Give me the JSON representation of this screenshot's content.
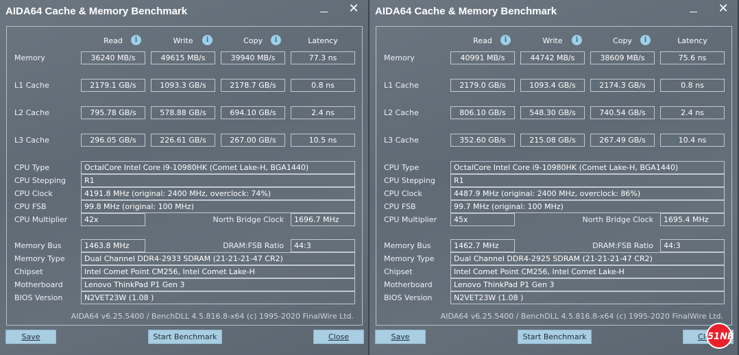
{
  "windows": [
    {
      "title": "AIDA64 Cache & Memory Benchmark",
      "headers": {
        "read": "Read",
        "write": "Write",
        "copy": "Copy",
        "latency": "Latency"
      },
      "bench": [
        {
          "label": "Memory",
          "read": "36240 MB/s",
          "write": "49615 MB/s",
          "copy": "39940 MB/s",
          "latency": "77.3 ns"
        },
        {
          "label": "L1 Cache",
          "read": "2179.1 GB/s",
          "write": "1093.3 GB/s",
          "copy": "2178.7 GB/s",
          "latency": "0.8 ns"
        },
        {
          "label": "L2 Cache",
          "read": "795.78 GB/s",
          "write": "578.88 GB/s",
          "copy": "694.10 GB/s",
          "latency": "2.4 ns"
        },
        {
          "label": "L3 Cache",
          "read": "296.05 GB/s",
          "write": "226.61 GB/s",
          "copy": "267.00 GB/s",
          "latency": "10.5 ns"
        }
      ],
      "info": {
        "cpu_type_label": "CPU Type",
        "cpu_type": "OctalCore Intel Core i9-10980HK  (Comet Lake-H, BGA1440)",
        "cpu_stepping_label": "CPU Stepping",
        "cpu_stepping": "R1",
        "cpu_clock_label": "CPU Clock",
        "cpu_clock": "4191.8 MHz  (original: 2400 MHz, overclock: 74%)",
        "cpu_fsb_label": "CPU FSB",
        "cpu_fsb": "99.8 MHz  (original: 100 MHz)",
        "cpu_multiplier_label": "CPU Multiplier",
        "cpu_multiplier": "42x",
        "nb_clock_label": "North Bridge Clock",
        "nb_clock": "1696.7 MHz",
        "memory_bus_label": "Memory Bus",
        "memory_bus": "1463.8 MHz",
        "dram_fsb_label": "DRAM:FSB Ratio",
        "dram_fsb": "44:3",
        "memory_type_label": "Memory Type",
        "memory_type": "Dual Channel DDR4-2933 SDRAM  (21-21-21-47 CR2)",
        "chipset_label": "Chipset",
        "chipset": "Intel Comet Point CM256, Intel Comet Lake-H",
        "motherboard_label": "Motherboard",
        "motherboard": "Lenovo ThinkPad P1 Gen 3",
        "bios_label": "BIOS Version",
        "bios": "N2VET23W (1.08 )"
      },
      "footer": "AIDA64 v6.25.5400 / BenchDLL 4.5.816.8-x64  (c) 1995-2020 FinalWire Ltd.",
      "buttons": {
        "save": "Save",
        "start": "Start Benchmark",
        "close": "Close"
      }
    },
    {
      "title": "AIDA64 Cache & Memory Benchmark",
      "headers": {
        "read": "Read",
        "write": "Write",
        "copy": "Copy",
        "latency": "Latency"
      },
      "bench": [
        {
          "label": "Memory",
          "read": "40991 MB/s",
          "write": "44742 MB/s",
          "copy": "38609 MB/s",
          "latency": "75.6 ns"
        },
        {
          "label": "L1 Cache",
          "read": "2179.0 GB/s",
          "write": "1093.4 GB/s",
          "copy": "2174.3 GB/s",
          "latency": "0.8 ns"
        },
        {
          "label": "L2 Cache",
          "read": "806.10 GB/s",
          "write": "548.30 GB/s",
          "copy": "740.54 GB/s",
          "latency": "2.4 ns"
        },
        {
          "label": "L3 Cache",
          "read": "352.60 GB/s",
          "write": "215.08 GB/s",
          "copy": "267.49 GB/s",
          "latency": "10.4 ns"
        }
      ],
      "info": {
        "cpu_type_label": "CPU Type",
        "cpu_type": "OctalCore Intel Core i9-10980HK  (Comet Lake-H, BGA1440)",
        "cpu_stepping_label": "CPU Stepping",
        "cpu_stepping": "R1",
        "cpu_clock_label": "CPU Clock",
        "cpu_clock": "4487.9 MHz  (original: 2400 MHz, overclock: 86%)",
        "cpu_fsb_label": "CPU FSB",
        "cpu_fsb": "99.7 MHz  (original: 100 MHz)",
        "cpu_multiplier_label": "CPU Multiplier",
        "cpu_multiplier": "45x",
        "nb_clock_label": "North Bridge Clock",
        "nb_clock": "1695.4 MHz",
        "memory_bus_label": "Memory Bus",
        "memory_bus": "1462.7 MHz",
        "dram_fsb_label": "DRAM:FSB Ratio",
        "dram_fsb": "44:3",
        "memory_type_label": "Memory Type",
        "memory_type": "Dual Channel DDR4-2925 SDRAM  (21-21-21-47 CR2)",
        "chipset_label": "Chipset",
        "chipset": "Intel Comet Point CM256, Intel Comet Lake-H",
        "motherboard_label": "Motherboard",
        "motherboard": "Lenovo ThinkPad P1 Gen 3",
        "bios_label": "BIOS Version",
        "bios": "N2VET23W (1.08 )"
      },
      "footer": "AIDA64 v6.25.5400 / BenchDLL 4.5.816.8-x64  (c) 1995-2020 FinalWire Ltd.",
      "buttons": {
        "save": "Save",
        "start": "Start Benchmark",
        "close": "Close"
      }
    }
  ],
  "watermark": "51NB",
  "icons": {
    "info": "info-icon",
    "minimize": "minimize-icon",
    "close": "close-icon"
  }
}
